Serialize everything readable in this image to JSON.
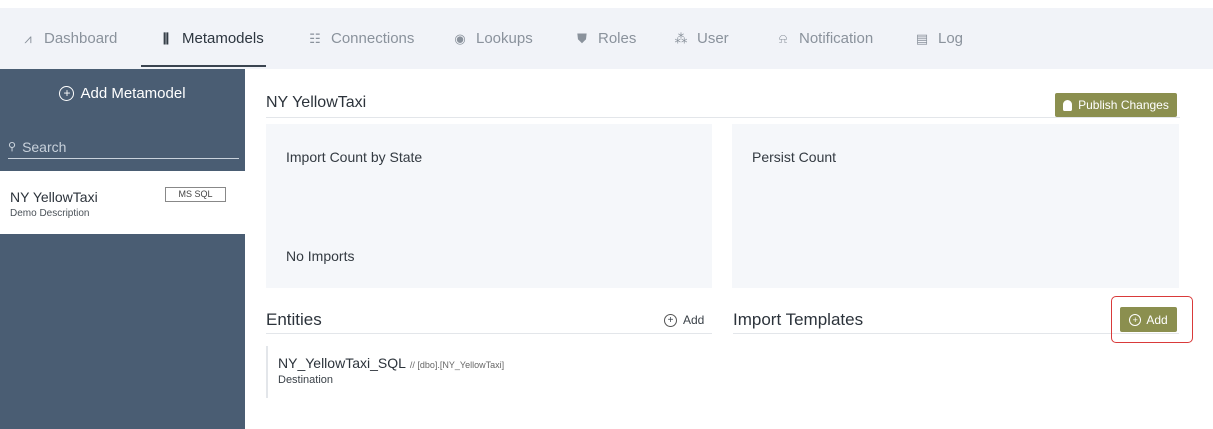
{
  "nav": {
    "items": [
      {
        "label": "Dashboard",
        "icon": "chart-icon",
        "glyph": "⩘",
        "active": false
      },
      {
        "label": "Metamodels",
        "icon": "books-icon",
        "glyph": "⫼",
        "active": true
      },
      {
        "label": "Connections",
        "icon": "connections-icon",
        "glyph": "☷",
        "active": false
      },
      {
        "label": "Lookups",
        "icon": "eye-icon",
        "glyph": "◉",
        "active": false
      },
      {
        "label": "Roles",
        "icon": "shield-icon",
        "glyph": "⛊",
        "active": false
      },
      {
        "label": "User",
        "icon": "users-icon",
        "glyph": "⁂",
        "active": false
      },
      {
        "label": "Notification",
        "icon": "bell-icon",
        "glyph": "⍾",
        "active": false
      },
      {
        "label": "Log",
        "icon": "document-icon",
        "glyph": "▤",
        "active": false
      }
    ]
  },
  "sidebar": {
    "add_label": "Add Metamodel",
    "search_placeholder": "Search",
    "models": [
      {
        "name": "NY YellowTaxi",
        "description": "Demo Description",
        "badge": "MS SQL"
      }
    ]
  },
  "main": {
    "title": "NY YellowTaxi",
    "publish_label": "Publish Changes",
    "import_panel": {
      "title": "Import Count by State",
      "empty_text": "No Imports"
    },
    "persist_panel": {
      "title": "Persist Count"
    },
    "entities": {
      "title": "Entities",
      "add_label": "Add",
      "rows": [
        {
          "name": "NY_YellowTaxi_SQL",
          "path": "// [dbo].[NY_YellowTaxi]",
          "type": "Destination"
        }
      ]
    },
    "import_templates": {
      "title": "Import Templates",
      "add_label": "Add"
    }
  },
  "colors": {
    "sidebar_bg": "#4a5d73",
    "accent_olive": "#8b8f4f",
    "highlight_red": "#d93a3a",
    "nav_bg": "#f1f3f8"
  }
}
